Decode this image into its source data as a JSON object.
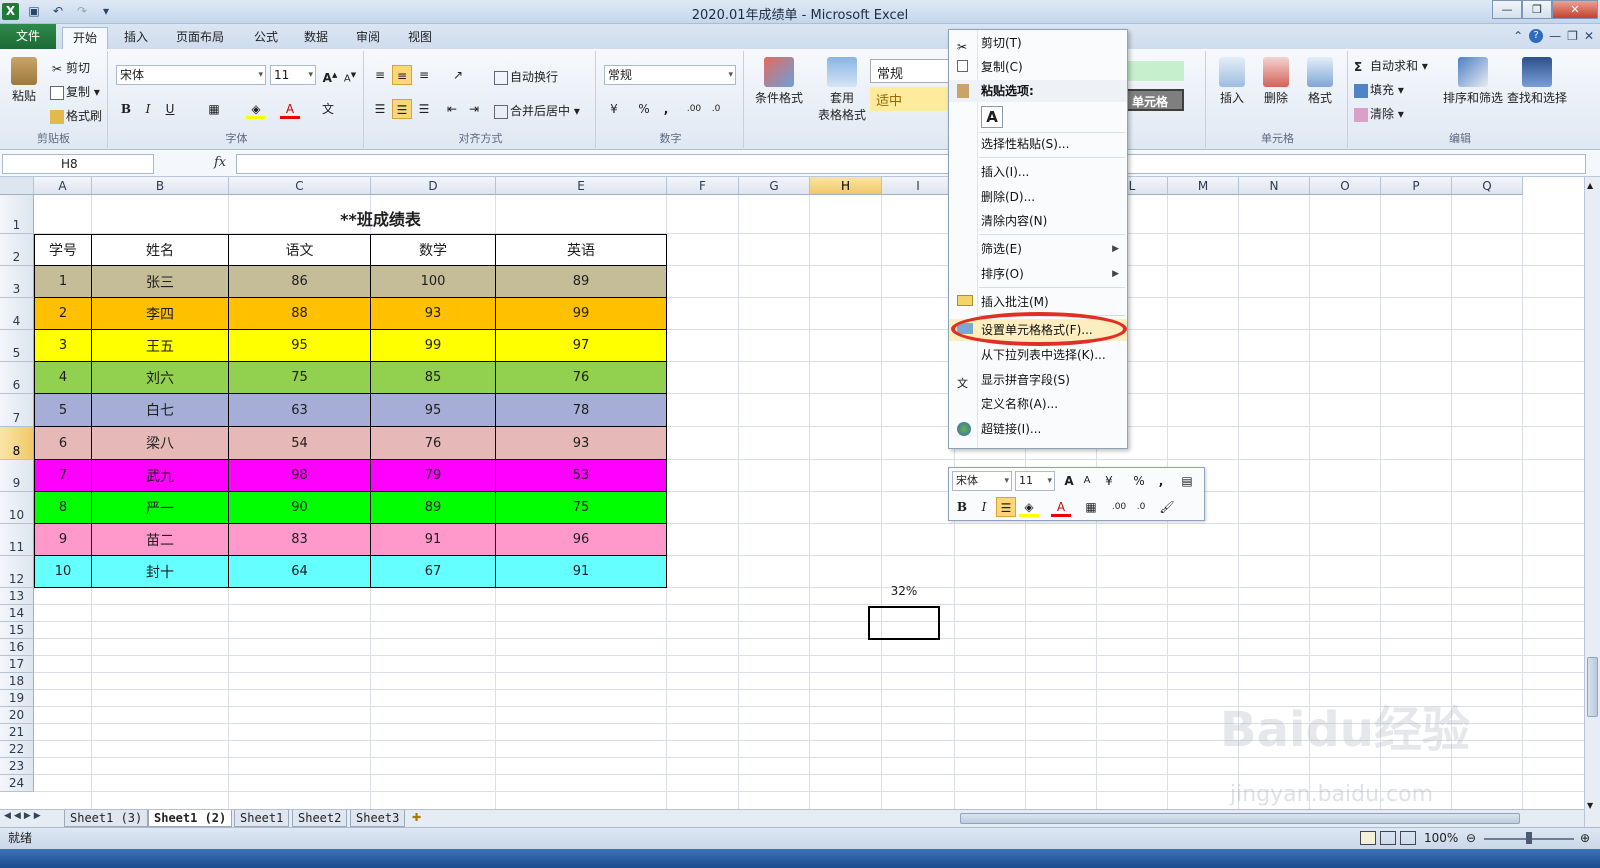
{
  "window": {
    "title": "2020.01年成绩单 - Microsoft Excel"
  },
  "ribbon_tabs": [
    {
      "label": "文件"
    },
    {
      "label": "开始"
    },
    {
      "label": "插入"
    },
    {
      "label": "页面布局"
    },
    {
      "label": "公式"
    },
    {
      "label": "数据"
    },
    {
      "label": "审阅"
    },
    {
      "label": "视图"
    }
  ],
  "clipboard": {
    "paste": "粘贴",
    "cut": "剪切",
    "copy": "复制",
    "format_painter": "格式刷",
    "group": "剪贴板"
  },
  "font": {
    "name": "宋体",
    "size": "11",
    "group": "字体",
    "bold": "B",
    "italic": "I",
    "underline": "U"
  },
  "alignment": {
    "wrap": "自动换行",
    "merge": "合并后居中",
    "group": "对齐方式"
  },
  "number": {
    "format": "常规",
    "group": "数字",
    "percent": "%",
    "comma": ","
  },
  "styles": {
    "conditional": "条件格式",
    "table_line1": "套用",
    "table_line2": "表格格式",
    "style_normal": "常规",
    "style_neutral": "适中",
    "style_cell": "单元格"
  },
  "cells": {
    "insert": "插入",
    "delete": "删除",
    "format": "格式",
    "group": "单元格"
  },
  "editing": {
    "autosum": "自动求和",
    "fill": "填充",
    "clear": "清除",
    "sort": "排序和筛选",
    "find": "查找和选择",
    "group": "编辑"
  },
  "formula_bar": {
    "name_box": "H8",
    "fx": "fx",
    "content": ""
  },
  "columns": [
    "A",
    "B",
    "C",
    "D",
    "E",
    "F",
    "G",
    "H",
    "I",
    "J",
    "K",
    "L",
    "M",
    "N",
    "O",
    "P",
    "Q"
  ],
  "rows": [
    "1",
    "2",
    "3",
    "4",
    "5",
    "6",
    "7",
    "8",
    "9",
    "10",
    "11",
    "12",
    "13",
    "14",
    "15",
    "16",
    "17",
    "18",
    "19",
    "20",
    "21",
    "22",
    "23",
    "24"
  ],
  "selected_cell": "H8",
  "sheet": {
    "title": "**班成绩表",
    "headers": [
      "学号",
      "姓名",
      "语文",
      "数学",
      "英语"
    ],
    "records": [
      {
        "id": "1",
        "name": "张三",
        "chinese": "86",
        "math": "100",
        "english": "89",
        "color": "#c4bd97"
      },
      {
        "id": "2",
        "name": "李四",
        "chinese": "88",
        "math": "93",
        "english": "99",
        "color": "#ffc000"
      },
      {
        "id": "3",
        "name": "王五",
        "chinese": "95",
        "math": "99",
        "english": "97",
        "color": "#ffff00"
      },
      {
        "id": "4",
        "name": "刘六",
        "chinese": "75",
        "math": "85",
        "english": "76",
        "color": "#92d050"
      },
      {
        "id": "5",
        "name": "白七",
        "chinese": "63",
        "math": "95",
        "english": "78",
        "color": "#a6aed8"
      },
      {
        "id": "6",
        "name": "梁八",
        "chinese": "54",
        "math": "76",
        "english": "93",
        "color": "#e6b9b8"
      },
      {
        "id": "7",
        "name": "武九",
        "chinese": "98",
        "math": "79",
        "english": "53",
        "color": "#ff00ff"
      },
      {
        "id": "8",
        "name": "严一",
        "chinese": "90",
        "math": "89",
        "english": "75",
        "color": "#00ff00"
      },
      {
        "id": "9",
        "name": "苗二",
        "chinese": "83",
        "math": "91",
        "english": "96",
        "color": "#ff99cc"
      },
      {
        "id": "10",
        "name": "封十",
        "chinese": "64",
        "math": "67",
        "english": "91",
        "color": "#66ffff"
      }
    ],
    "h7_value": "32%"
  },
  "context_menu": {
    "items": [
      {
        "label": "剪切(T)"
      },
      {
        "label": "复制(C)"
      },
      {
        "label": "粘贴选项:"
      },
      {
        "label": "A"
      },
      {
        "label": "选择性粘贴(S)..."
      },
      {
        "label": "插入(I)..."
      },
      {
        "label": "删除(D)..."
      },
      {
        "label": "清除内容(N)"
      },
      {
        "label": "筛选(E)"
      },
      {
        "label": "排序(O)"
      },
      {
        "label": "插入批注(M)"
      },
      {
        "label": "设置单元格格式(F)..."
      },
      {
        "label": "从下拉列表中选择(K)..."
      },
      {
        "label": "显示拼音字段(S)"
      },
      {
        "label": "定义名称(A)..."
      },
      {
        "label": "超链接(I)..."
      }
    ],
    "highlight_color": "#e03025"
  },
  "mini_toolbar": {
    "font": "宋体",
    "size": "11",
    "bold": "B",
    "italic": "I",
    "percent": "%",
    "comma": ","
  },
  "sheet_tabs": [
    {
      "label": "Sheet1 (3)"
    },
    {
      "label": "Sheet1 (2)"
    },
    {
      "label": "Sheet1"
    },
    {
      "label": "Sheet2"
    },
    {
      "label": "Sheet3"
    }
  ],
  "status": {
    "ready": "就绪",
    "zoom": "100%"
  },
  "watermark": {
    "logo": "Baidu经验",
    "url": "jingyan.baidu.com"
  }
}
